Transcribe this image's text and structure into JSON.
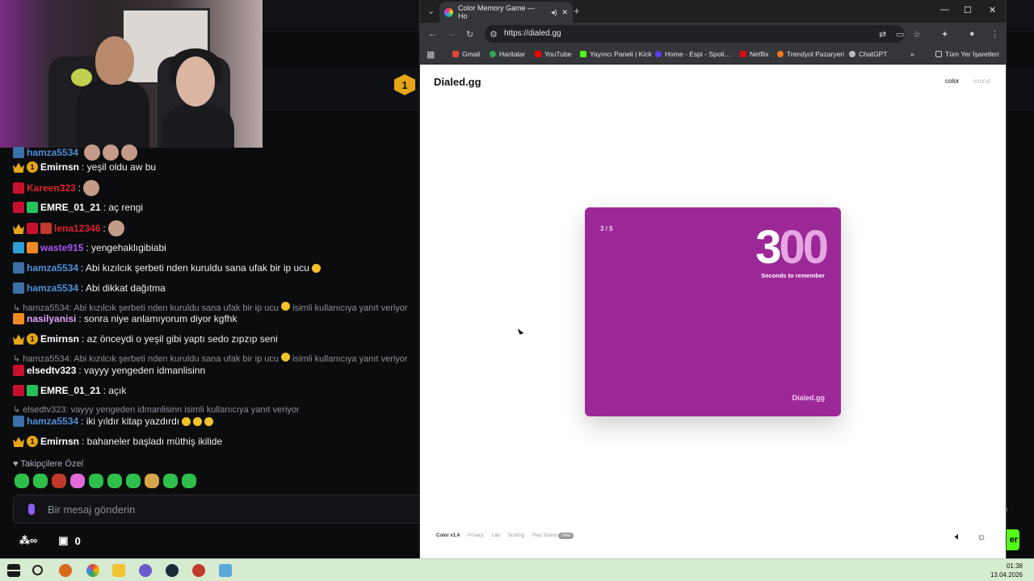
{
  "browser": {
    "tab_title": "Color Memory Game — Ho",
    "url": "https://dialed.gg",
    "bookmarks": [
      "Gmail",
      "Haritalar",
      "YouTube",
      "Yayıncı Paneli | Kick",
      "Home - Espi - Spoti...",
      "Netflix",
      "Trendyol Pazaryeri",
      "ChatGPT",
      "Tüm Yer İşaretleri"
    ]
  },
  "page": {
    "logo": "Dialed.gg",
    "nav_color": "color",
    "nav_sound": "sound",
    "card": {
      "counter": "3 / 5",
      "big_digit": "3",
      "big_faded": "00",
      "subtitle": "Seconds to remember",
      "watermark": "Dialed.gg",
      "background": "#9c2898"
    },
    "footer": {
      "version": "Color v1.4",
      "privacy": "Privacy",
      "lab": "Lab",
      "scoring": "Scoring",
      "play_sound": "Play Sound",
      "new_badge": "new"
    }
  },
  "stream": {
    "chat_messages": [
      {
        "user": "Emirnsn",
        "text": ": yeşil oldu aw bu",
        "color": "#ffffff"
      },
      {
        "user": "Kareen323",
        "text": ":",
        "color": "#e0212c"
      },
      {
        "user": "EMRE_01_21",
        "text": ": aç rengi",
        "color": "#ffffff"
      },
      {
        "user": "lena12346",
        "text": ":",
        "color": "#e0212c"
      },
      {
        "user": "waste915",
        "text": ": yengehaklıgibiabi",
        "color": "#a855f7"
      },
      {
        "user": "hamza5534",
        "text": ": Abi kızılcık şerbeti nden kuruldu sana ufak bir ip ucu",
        "color": "#4f8fd6"
      },
      {
        "user": "hamza5534",
        "text": ": Abi dikkat dağıtma",
        "color": "#4f8fd6"
      },
      {
        "user": "nasilyanisi",
        "text": ": sonra niye anlamıyorum diyor kgfhk",
        "color": "#e3a4ff"
      },
      {
        "user": "Emirnsn",
        "text": ": az önceydi o yeşil gibi yaptı sedo zıpzıp seni",
        "color": "#ffffff"
      },
      {
        "user": "elsedtv323",
        "text": ": vayyy yengeden idmanlisinn",
        "color": "#ffffff"
      },
      {
        "user": "EMRE_01_21",
        "text": ": açık",
        "color": "#ffffff"
      },
      {
        "user": "hamza5534",
        "text": ": iki yıldır kitap yazdırdı",
        "color": "#4f8fd6"
      },
      {
        "user": "Emirnsn",
        "text": ": bahaneler başladı müthiş ikilide",
        "color": "#ffffff"
      }
    ],
    "replies": [
      "hamza5534: Abi kızılcık şerbeti nden kuruldu sana ufak bir ip ucu",
      "isimli kullanıcıya yanıt veriyor",
      "hamza5534: Abi kızılcık şerbeti nden kuruldu sana ufak bir ip ucu",
      "isimli kullanıcıya yanıt veriyor",
      "elsedtv323: vayyy yengeden idmanlisinn isimli kullanıcıya yanıt veriyor"
    ],
    "top_user": "hamza5534",
    "sub_only": "Takipçilere Özel",
    "input_placeholder": "Bir mesaj gönderin",
    "footer_count": "0",
    "badge_num": "1",
    "side_text": "er",
    "side_num": "9"
  },
  "taskbar": {
    "time": "01:38",
    "date": "13.04.2026"
  }
}
